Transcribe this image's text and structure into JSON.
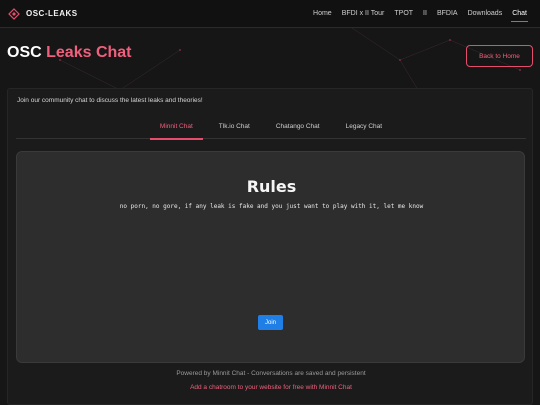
{
  "navbar": {
    "brand": "OSC-LEAKS",
    "links": [
      "Home",
      "BFDI x II Tour",
      "TPOT",
      "II",
      "BFDIA",
      "Downloads",
      "Chat"
    ],
    "active": "Chat"
  },
  "hero": {
    "title_prefix": "OSC",
    "title_accent": "Leaks Chat",
    "back_label": "Back to Home"
  },
  "panel": {
    "intro": "Join our community chat to discuss the latest leaks and theories!",
    "tabs": [
      "Minnit Chat",
      "Tlk.io Chat",
      "Chatango Chat",
      "Legacy Chat"
    ],
    "active_tab": "Minnit Chat"
  },
  "chat": {
    "rules_title": "Rules",
    "rules_text": "no porn, no gore, if any leak is fake and you just want to play with it, let me know",
    "join_label": "Join"
  },
  "footer": {
    "powered": "Powered by Minnit Chat - Conversations are saved and persistent",
    "add_link": "Add a chatroom to your website for free with Minnit Chat"
  },
  "colors": {
    "accent": "#e64d6d",
    "background": "#161616",
    "chat_bg": "#2d2d2d",
    "join_button": "#1f7fe6"
  }
}
